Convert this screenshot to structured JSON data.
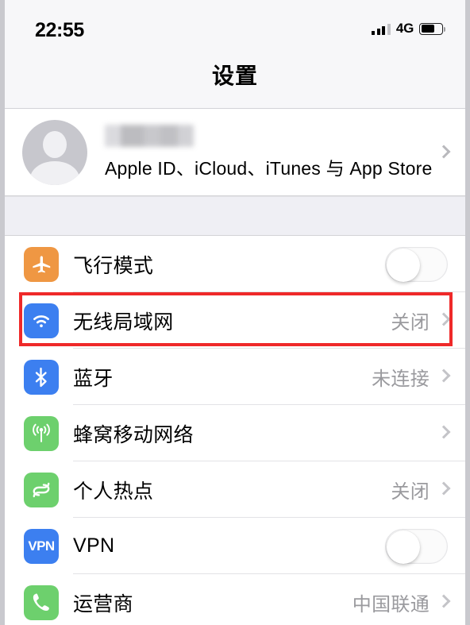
{
  "status_bar": {
    "time": "22:55",
    "network_label": "4G",
    "signal_bars_filled": 3,
    "signal_bars_total": 4,
    "battery_percent": 58,
    "signal_icon": "signal-bars-icon",
    "battery_icon": "battery-icon"
  },
  "header": {
    "title": "设置"
  },
  "account": {
    "name": "",
    "name_redacted": true,
    "subtitle": "Apple ID、iCloud、iTunes 与 App Store",
    "avatar_icon": "person-placeholder-avatar-icon",
    "chevron_icon": "chevron-right-icon"
  },
  "colors": {
    "airplane": "#ef9743",
    "wifi": "#3c7ff0",
    "bluetooth": "#3c7ff0",
    "cellular": "#6dd06d",
    "hotspot": "#6dd06d",
    "vpn": "#3c7ff0",
    "carrier": "#6dd06d",
    "highlight_box": "#ef2929",
    "value_text": "#9a9a9e",
    "chevron": "#c4c4c8",
    "page_background": "#efeff4"
  },
  "settings_rows": [
    {
      "id": "airplane-mode",
      "label": "飞行模式",
      "icon": "airplane-icon",
      "control": "toggle",
      "toggle_on": false,
      "value": ""
    },
    {
      "id": "wifi",
      "label": "无线局域网",
      "icon": "wifi-icon",
      "control": "chevron",
      "value": "关闭",
      "highlighted": true
    },
    {
      "id": "bluetooth",
      "label": "蓝牙",
      "icon": "bluetooth-icon",
      "control": "chevron",
      "value": "未连接"
    },
    {
      "id": "cellular",
      "label": "蜂窝移动网络",
      "icon": "cellular-antenna-icon",
      "control": "chevron",
      "value": ""
    },
    {
      "id": "personal-hotspot",
      "label": "个人热点",
      "icon": "hotspot-links-icon",
      "control": "chevron",
      "value": "关闭"
    },
    {
      "id": "vpn",
      "label": "VPN",
      "icon": "vpn-icon",
      "icon_text": "VPN",
      "control": "toggle",
      "toggle_on": false,
      "value": ""
    },
    {
      "id": "carrier",
      "label": "运营商",
      "icon": "phone-handset-icon",
      "control": "chevron",
      "value": "中国联通"
    }
  ]
}
